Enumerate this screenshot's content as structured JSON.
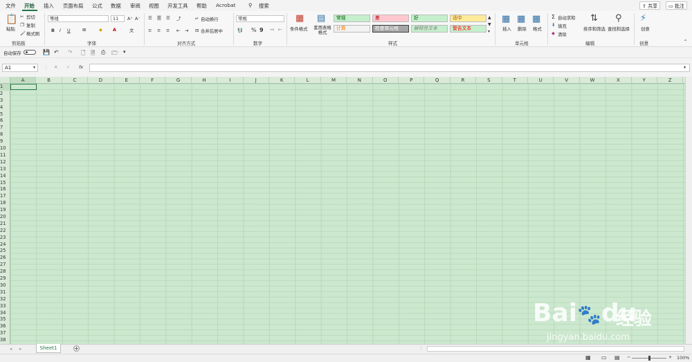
{
  "menu": {
    "items": [
      "文件",
      "开始",
      "插入",
      "页面布局",
      "公式",
      "数据",
      "审阅",
      "视图",
      "开发工具",
      "帮助",
      "Acrobat"
    ],
    "search_label": "搜索",
    "share_label": "共享",
    "comments_label": "批注"
  },
  "ribbon": {
    "clipboard": {
      "paste": "粘贴",
      "cut": "剪切",
      "copy": "复制",
      "format_painter": "格式刷",
      "group": "剪贴板"
    },
    "font": {
      "name": "等线",
      "size": "11",
      "bold": "B",
      "italic": "I",
      "underline": "U",
      "group": "字体"
    },
    "alignment": {
      "wrap": "自动换行",
      "merge": "合并后居中",
      "group": "对齐方式"
    },
    "number": {
      "format": "常规",
      "percent": "%",
      "comma": "9",
      "group": "数字"
    },
    "styles": {
      "conditional": "条件格式",
      "table_format": "套用表格格式",
      "cells": [
        {
          "label": "常规",
          "bg": "#c6efce",
          "fg": "#006100"
        },
        {
          "label": "差",
          "bg": "#ffc7ce",
          "fg": "#9c0006"
        },
        {
          "label": "好",
          "bg": "#c6efce",
          "fg": "#006100"
        },
        {
          "label": "适中",
          "bg": "#ffeb9c",
          "fg": "#9c5700"
        },
        {
          "label": "计算",
          "bg": "#f2f2f2",
          "fg": "#fa7d00"
        },
        {
          "label": "检查单元格",
          "bg": "#a5a5a5",
          "fg": "#ffffff"
        },
        {
          "label": "解释性文本",
          "bg": "#c6efce",
          "fg": "#7f7f7f"
        },
        {
          "label": "警告文本",
          "bg": "#c6efce",
          "fg": "#ff0000"
        }
      ],
      "group": "样式"
    },
    "cells": {
      "insert": "插入",
      "delete": "删除",
      "format": "格式",
      "group": "单元格"
    },
    "editing": {
      "autosum": "自动求和",
      "fill": "填充",
      "clear": "清除",
      "sort": "排序和筛选",
      "find": "查找和选择",
      "group": "编辑"
    },
    "creativity": {
      "create": "创意",
      "group": "创意"
    }
  },
  "qat": {
    "autosave": "自动保存"
  },
  "formula_bar": {
    "name_box": "A1",
    "fx": "fx",
    "value": ""
  },
  "columns": [
    "A",
    "B",
    "C",
    "D",
    "E",
    "F",
    "G",
    "H",
    "I",
    "J",
    "K",
    "L",
    "M",
    "N",
    "O",
    "P",
    "Q",
    "R",
    "S",
    "T",
    "U",
    "V",
    "W",
    "X",
    "Y",
    "Z"
  ],
  "rows": [
    "1",
    "2",
    "3",
    "4",
    "5",
    "6",
    "7",
    "8",
    "9",
    "10",
    "11",
    "12",
    "13",
    "14",
    "15",
    "16",
    "17",
    "18",
    "19",
    "20",
    "21",
    "22",
    "23",
    "24",
    "25",
    "26",
    "27",
    "28",
    "29",
    "30",
    "31",
    "32",
    "33",
    "34",
    "35",
    "36",
    "37",
    "38"
  ],
  "sheet": {
    "tab": "Sheet1",
    "add": "+"
  },
  "status": {
    "zoom": "100%"
  },
  "watermark": {
    "brand": "Bai",
    "brand2": "du",
    "site_cn": "经验",
    "url": "jingyan.baidu.com"
  }
}
